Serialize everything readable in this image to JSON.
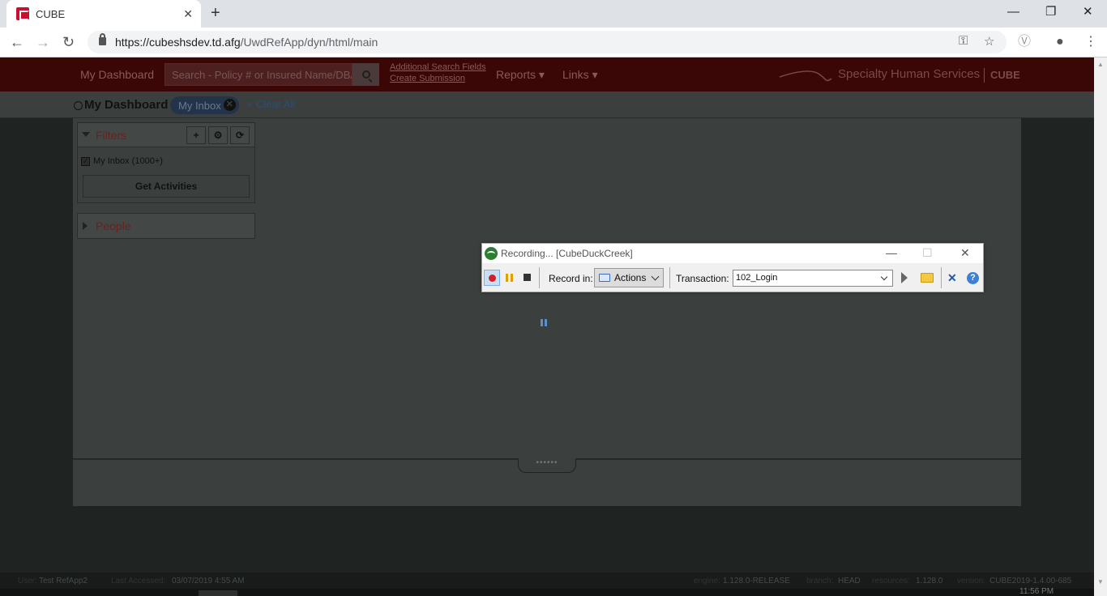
{
  "browser": {
    "tab_title": "CUBE",
    "tab_close": "✕",
    "new_tab": "+",
    "url_host": "https://cubeshsdev.td.afg",
    "url_path": "/UwdRefApp/dyn/html/main",
    "win_minimize": "—",
    "win_restore": "❐",
    "win_close": "✕",
    "back": "←",
    "forward": "→",
    "reload": "↻",
    "key_icon": "⚿",
    "star_icon": "☆",
    "ext_icon": "Ⓥ",
    "account_icon": "●",
    "menu_icon": "⋮"
  },
  "nav": {
    "my_dashboard": "My Dashboard",
    "search_placeholder": "Search - Policy # or Insured Name/DBA",
    "additional_search": "Additional Search Fields",
    "create_submission": "Create Submission",
    "reports": "Reports ▾",
    "links": "Links ▾",
    "brand": "Specialty Human Services",
    "brand_cube": "CUBE"
  },
  "subnav": {
    "title": "My Dashboard",
    "pill": "My Inbox",
    "pill_close": "✕",
    "clear_all": "« Clear All"
  },
  "filters": {
    "title": "Filters",
    "add": "+",
    "settings": "⚙",
    "refresh": "⟳",
    "checkbox_mark": "✓",
    "item": "My Inbox (1000+)",
    "get_activities": "Get Activities"
  },
  "people": {
    "title": "People"
  },
  "splitter_grip": "••••••",
  "status": {
    "user_label": "User:",
    "user": "Test RefApp2",
    "last_accessed_label": "Last Accessed:",
    "last_accessed": "03/07/2019 4:55 AM",
    "engine_label": "engine:",
    "engine": "1.128.0-RELEASE",
    "branch_label": "branch:",
    "branch": "HEAD",
    "resources_label": "resources:",
    "resources": "1.128.0",
    "version_label": "version:",
    "version": "CUBE2019-1.4.00-685",
    "clock": "11:56 PM"
  },
  "recorder": {
    "title": "Recording... [CubeDuckCreek]",
    "minimize": "—",
    "maximize": "☐",
    "close": "✕",
    "record_in_label": "Record in:",
    "record_in_value": "Actions",
    "transaction_label": "Transaction:",
    "transaction_value": "102_Login",
    "help": "?",
    "collapse": "✕"
  },
  "colors": {
    "topnav_bg": "#3a0606",
    "accent_red": "#6a2020",
    "pill_bg": "#23344a",
    "spinner": "#5d8fc6"
  }
}
